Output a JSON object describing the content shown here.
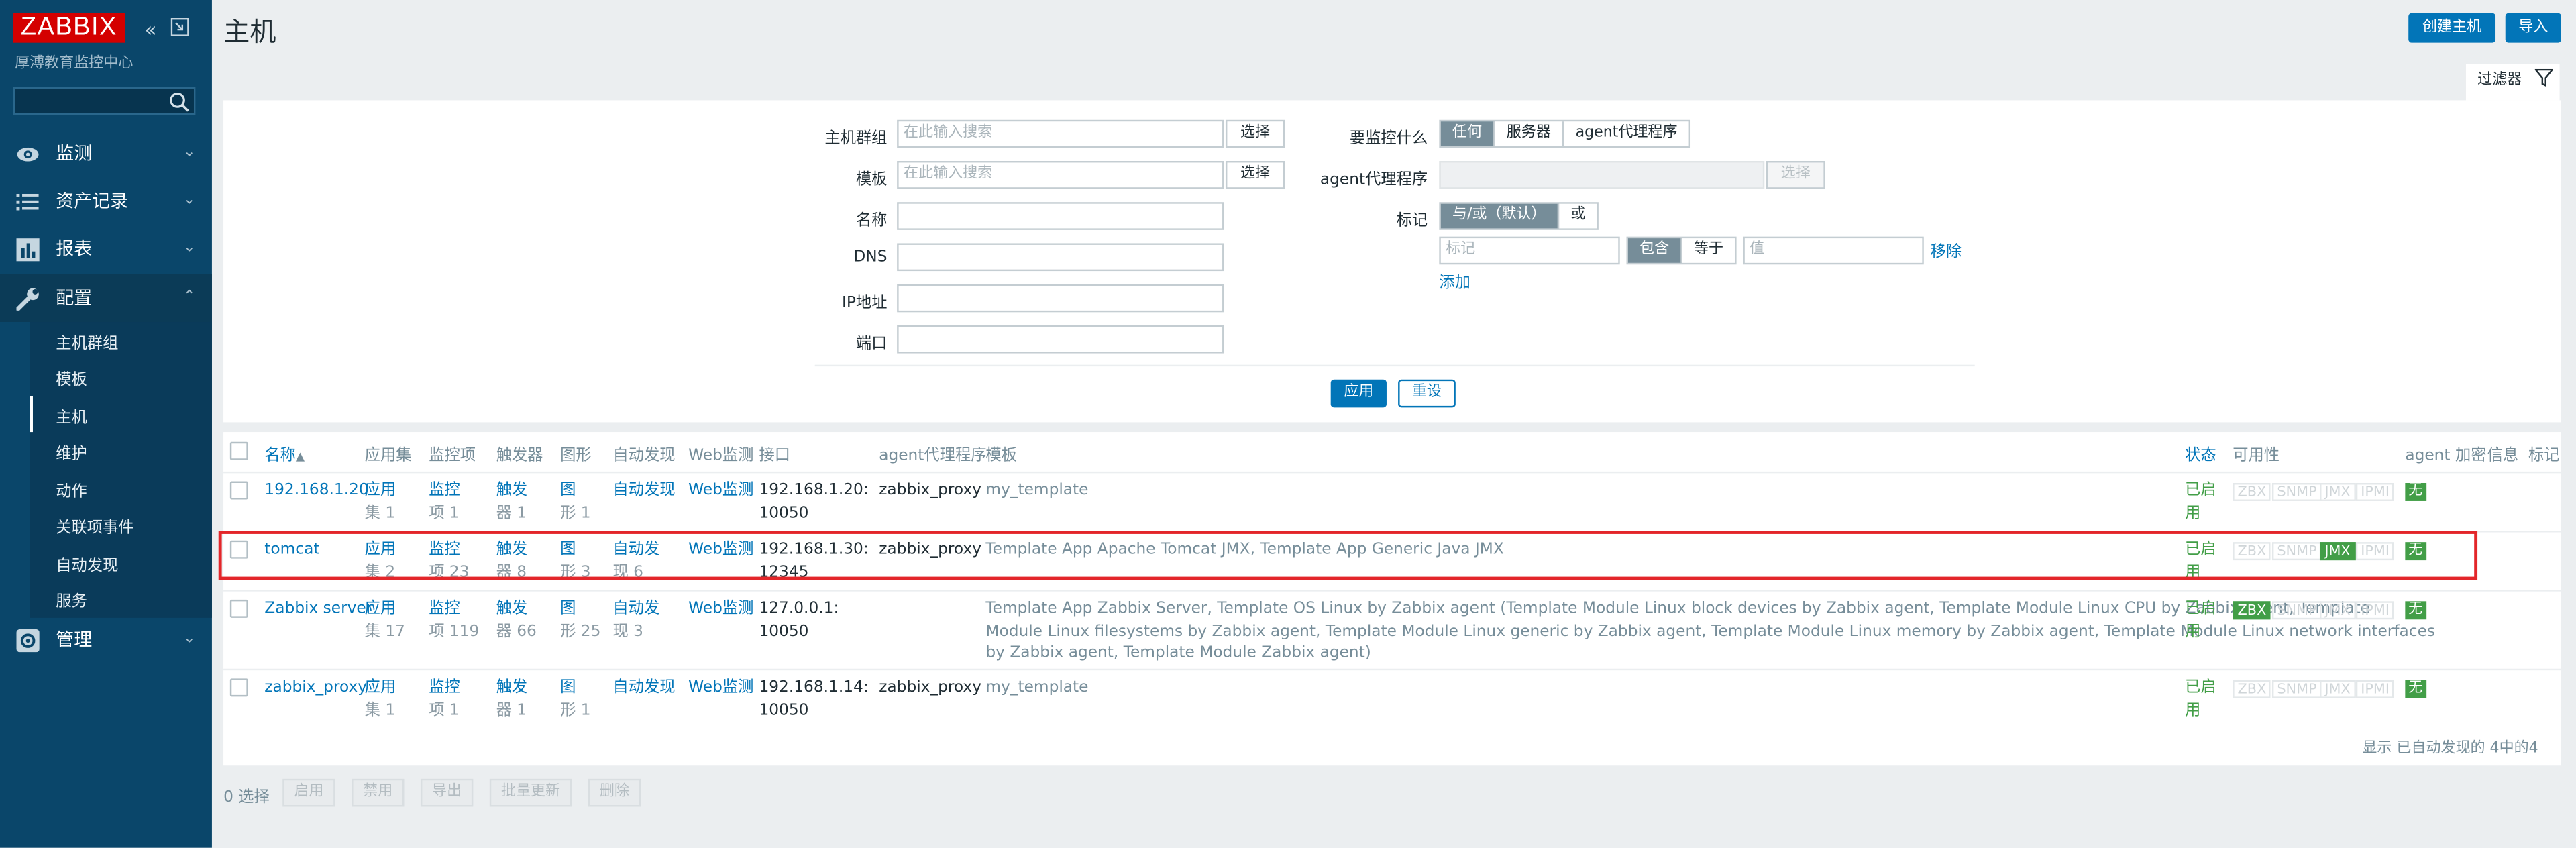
{
  "sidebar": {
    "logo": "ZABBIX",
    "subtitle": "厚溥教育监控中心",
    "search_value": "",
    "menu": [
      {
        "label": "监测"
      },
      {
        "label": "资产记录"
      },
      {
        "label": "报表"
      },
      {
        "label": "配置"
      },
      {
        "label": "管理"
      }
    ],
    "submenu": [
      {
        "label": "主机群组"
      },
      {
        "label": "模板"
      },
      {
        "label": "主机"
      },
      {
        "label": "维护"
      },
      {
        "label": "动作"
      },
      {
        "label": "关联项事件"
      },
      {
        "label": "自动发现"
      },
      {
        "label": "服务"
      }
    ],
    "active_submenu": "主机"
  },
  "header": {
    "title": "主机",
    "create_button": "创建主机",
    "import_button": "导入"
  },
  "filter": {
    "tab_label": "过滤器",
    "host_groups_label": "主机群组",
    "host_groups_placeholder": "在此输入搜索",
    "templates_label": "模板",
    "templates_placeholder": "在此输入搜索",
    "select_label": "选择",
    "name_label": "名称",
    "dns_label": "DNS",
    "ip_label": "IP地址",
    "port_label": "端口",
    "monitored_by_label": "要监控什么",
    "monitored_by_options": [
      "任何",
      "服务器",
      "agent代理程序"
    ],
    "monitored_by_selected": "任何",
    "proxy_label": "agent代理程序",
    "proxy_select": "选择",
    "tags_label": "标记",
    "tags_mode": [
      "与/或（默认）",
      "或"
    ],
    "tags_mode_selected": "与/或（默认）",
    "tag_placeholder": "标记",
    "tag_operators": [
      "包含",
      "等于"
    ],
    "tag_operator_selected": "包含",
    "value_placeholder": "值",
    "remove_label": "移除",
    "add_label": "添加",
    "apply_button": "应用",
    "reset_button": "重设"
  },
  "table": {
    "columns": [
      "名称",
      "应用集",
      "监控项",
      "触发器",
      "图形",
      "自动发现",
      "Web监测",
      "接口",
      "agent代理程序",
      "模板",
      "状态",
      "可用性",
      "agent 加密",
      "信息",
      "标记"
    ],
    "sort_indicator": "▲",
    "rows": [
      {
        "name": "192.168.1.20",
        "apps": [
          "应用",
          "集 1"
        ],
        "items": [
          "监控",
          "项 1"
        ],
        "triggers": [
          "触发",
          "器 1"
        ],
        "graphs": [
          "图",
          "形 1"
        ],
        "discovery": [
          "自动发现"
        ],
        "web": "Web监测",
        "interface": [
          "192.168.1.20:",
          "10050"
        ],
        "proxy": "zabbix_proxy",
        "templates": "my_template",
        "status": [
          "已启",
          "用"
        ],
        "availability": {
          "ZBX": false,
          "SNMP": false,
          "JMX": false,
          "IPMI": false
        },
        "encryption": "无"
      },
      {
        "name": "tomcat",
        "apps": [
          "应用",
          "集 2"
        ],
        "items": [
          "监控",
          "项 23"
        ],
        "triggers": [
          "触发",
          "器 8"
        ],
        "graphs": [
          "图",
          "形 3"
        ],
        "discovery": [
          "自动发",
          "现 6"
        ],
        "web": "Web监测",
        "interface": [
          "192.168.1.30:",
          "12345"
        ],
        "proxy": "zabbix_proxy",
        "templates": "Template App Apache Tomcat JMX, Template App Generic Java JMX",
        "status": [
          "已启",
          "用"
        ],
        "availability": {
          "ZBX": false,
          "SNMP": false,
          "JMX": true,
          "IPMI": false
        },
        "encryption": "无"
      },
      {
        "name": "Zabbix server",
        "apps": [
          "应用",
          "集 17"
        ],
        "items": [
          "监控",
          "项 119"
        ],
        "triggers": [
          "触发",
          "器 66"
        ],
        "graphs": [
          "图",
          "形 25"
        ],
        "discovery": [
          "自动发",
          "现 3"
        ],
        "web": "Web监测",
        "interface": [
          "127.0.0.1:",
          "10050"
        ],
        "proxy": "",
        "templates_lines": [
          "Template App Zabbix Server, Template OS Linux by Zabbix agent (Template Module Linux block devices by Zabbix agent, Template Module Linux CPU by Zabbix agent, Template",
          "Module Linux filesystems by Zabbix agent, Template Module Linux generic by Zabbix agent, Template Module Linux memory by Zabbix agent, Template Module Linux network interfaces",
          "by Zabbix agent, Template Module Zabbix agent)"
        ],
        "status": [
          "已启",
          "用"
        ],
        "availability": {
          "ZBX": true,
          "SNMP": false,
          "JMX": false,
          "IPMI": false
        },
        "encryption": "无"
      },
      {
        "name": "zabbix_proxy",
        "apps": [
          "应用",
          "集 1"
        ],
        "items": [
          "监控",
          "项 1"
        ],
        "triggers": [
          "触发",
          "器 1"
        ],
        "graphs": [
          "图",
          "形 1"
        ],
        "discovery": [
          "自动发现"
        ],
        "web": "Web监测",
        "interface": [
          "192.168.1.14:",
          "10050"
        ],
        "proxy": "zabbix_proxy",
        "templates": "my_template",
        "status": [
          "已启",
          "用"
        ],
        "availability": {
          "ZBX": false,
          "SNMP": false,
          "JMX": false,
          "IPMI": false
        },
        "encryption": "无"
      }
    ],
    "footer": "显示 已自动发现的 4中的4"
  },
  "mass_actions": {
    "selected": "0 选择",
    "buttons": [
      "启用",
      "禁用",
      "导出",
      "批量更新",
      "删除"
    ]
  },
  "colors": {
    "sidebar": "#0a466a",
    "accent": "#0275b8",
    "logo": "#d40000",
    "enabled": "#429e47",
    "highlight": "#e3262a"
  }
}
